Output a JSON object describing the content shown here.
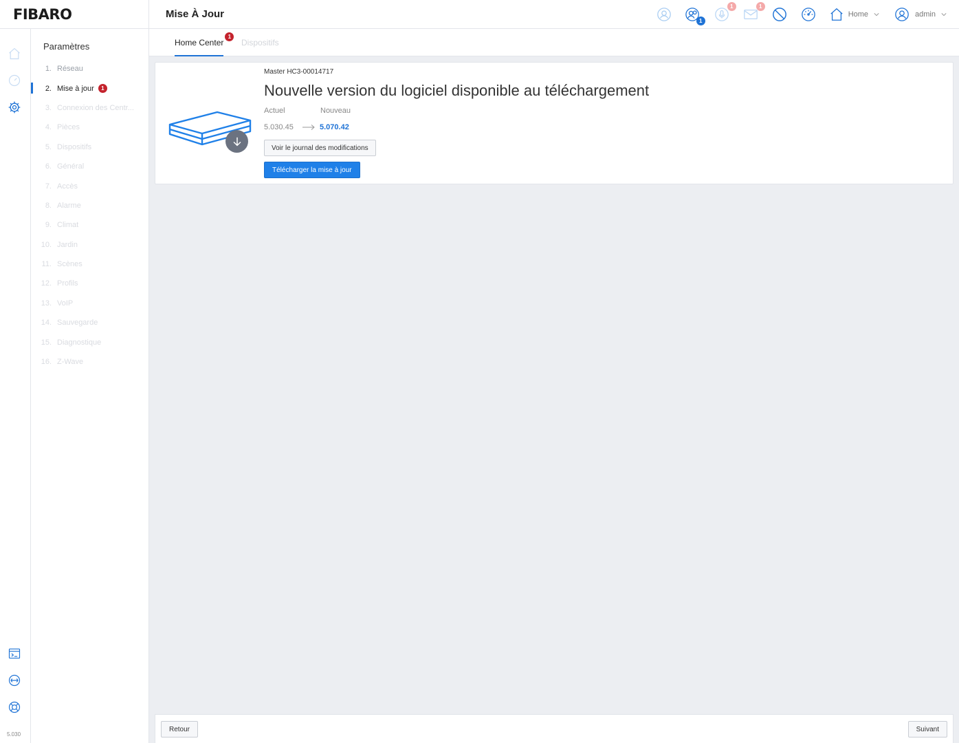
{
  "app": {
    "logo": "FIBARO",
    "page_title": "Mise À Jour",
    "version": "5.030"
  },
  "topbar": {
    "icons": [
      {
        "name": "user-circle-icon",
        "color": "#a9cdf2"
      },
      {
        "name": "users-icon",
        "badge": "1",
        "color": "#1f73d6"
      },
      {
        "name": "microphone-icon",
        "badge": "1",
        "color": "#b9d6f5"
      },
      {
        "name": "mail-icon",
        "badge": "1",
        "color": "#b9d6f5"
      },
      {
        "name": "block-icon",
        "color": "#1f73d6"
      },
      {
        "name": "gauge-icon",
        "color": "#1f73d6"
      }
    ],
    "home_label": "Home",
    "user_label": "admin"
  },
  "settings_menu": {
    "title": "Paramètres",
    "items": [
      {
        "num": "1.",
        "label": "Réseau"
      },
      {
        "num": "2.",
        "label": "Mise à jour",
        "badge": "1"
      },
      {
        "num": "3.",
        "label": "Connexion des Centr..."
      },
      {
        "num": "4.",
        "label": "Pièces"
      },
      {
        "num": "5.",
        "label": "Dispositifs"
      },
      {
        "num": "6.",
        "label": "Général"
      },
      {
        "num": "7.",
        "label": "Accès"
      },
      {
        "num": "8.",
        "label": "Alarme"
      },
      {
        "num": "9.",
        "label": "Climat"
      },
      {
        "num": "10.",
        "label": "Jardin"
      },
      {
        "num": "11.",
        "label": "Scènes"
      },
      {
        "num": "12.",
        "label": "Profils"
      },
      {
        "num": "13.",
        "label": "VoIP"
      },
      {
        "num": "14.",
        "label": "Sauvegarde"
      },
      {
        "num": "15.",
        "label": "Diagnostique"
      },
      {
        "num": "16.",
        "label": "Z-Wave"
      }
    ]
  },
  "tabs": {
    "home_center": "Home Center",
    "home_center_badge": "1",
    "dispositifs": "Dispositifs"
  },
  "update_card": {
    "device_name": "Master HC3-00014717",
    "headline": "Nouvelle version du logiciel disponible au téléchargement",
    "current_label": "Actuel",
    "new_label": "Nouveau",
    "current_version": "5.030.45",
    "new_version": "5.070.42",
    "changelog_button": "Voir le journal des modifications",
    "download_button": "Télécharger la mise à jour"
  },
  "footer": {
    "back": "Retour",
    "next": "Suivant"
  },
  "colors": {
    "accent": "#1f73d6",
    "badge": "#c4232d",
    "background": "#eceef2"
  }
}
